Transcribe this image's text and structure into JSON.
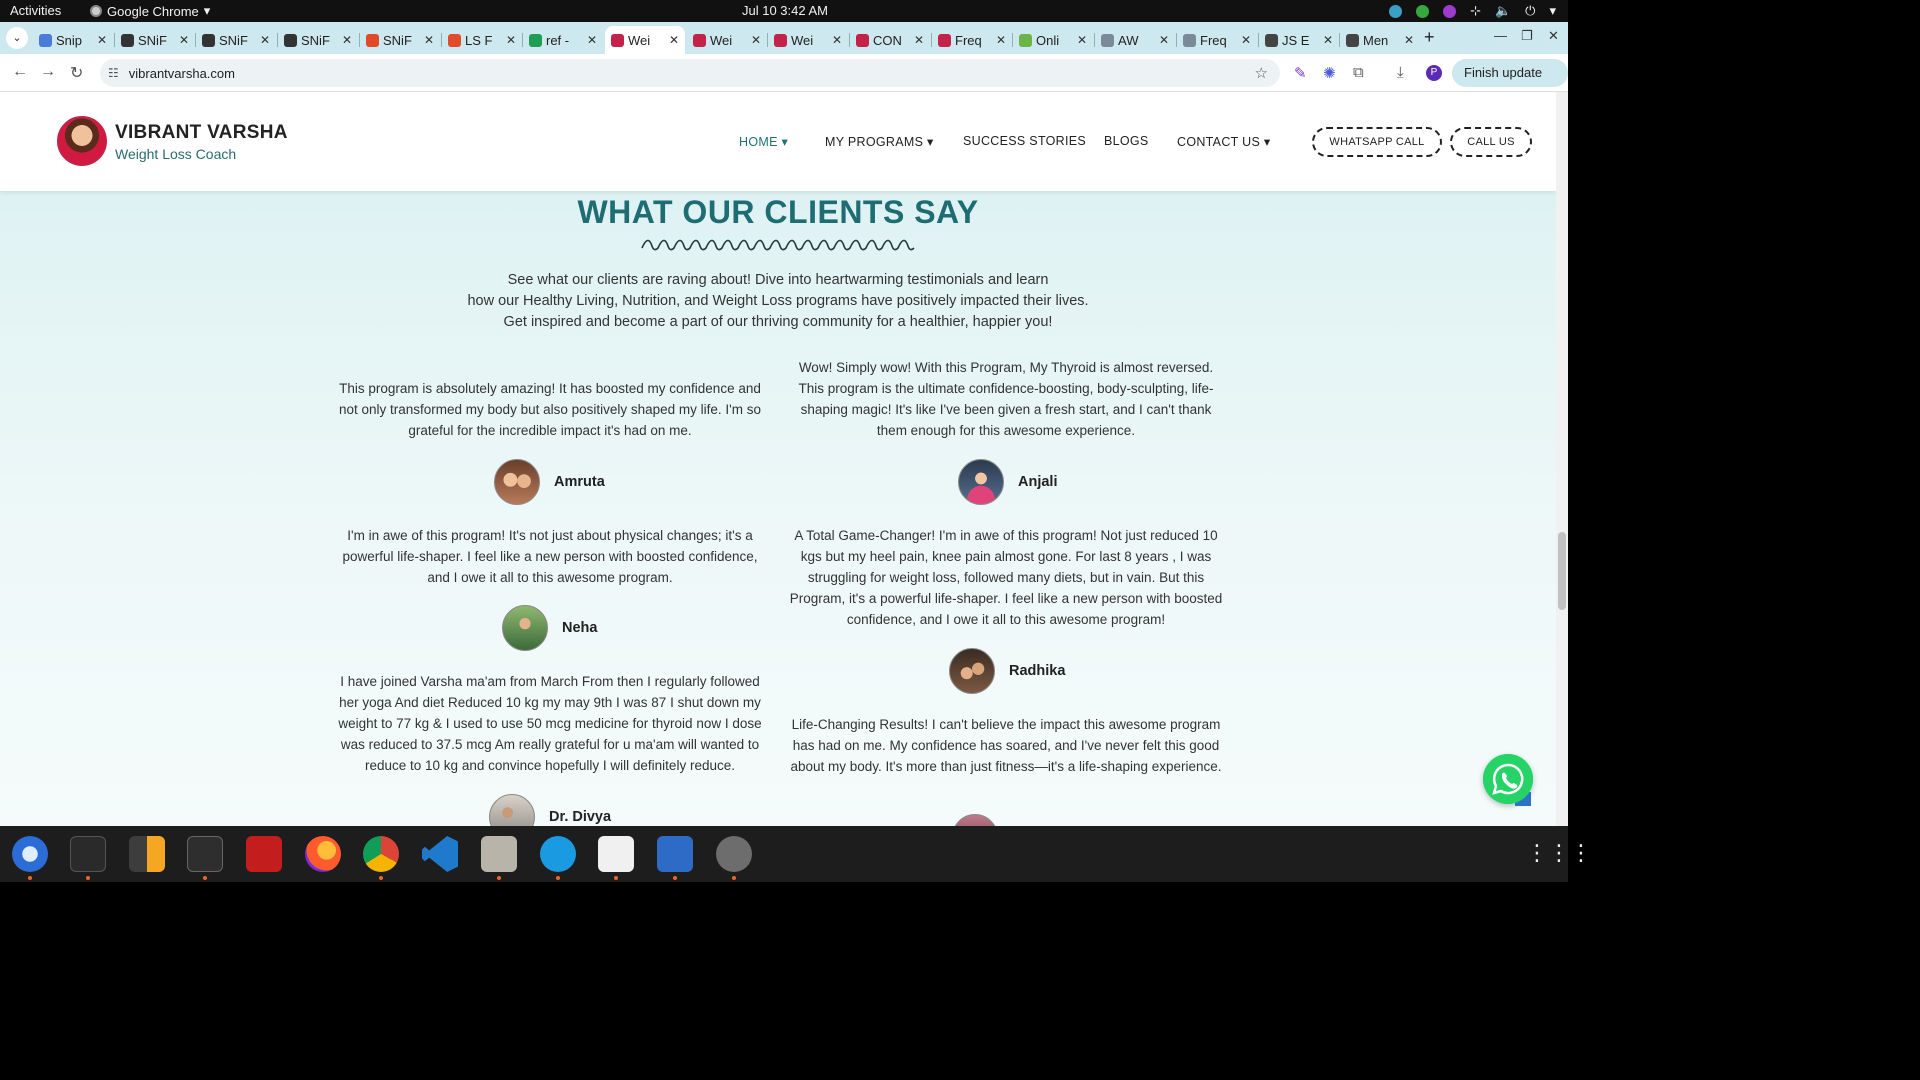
{
  "system": {
    "activities": "Activities",
    "app_name": "Google Chrome",
    "clock": "Jul 10  3:42 AM"
  },
  "tabs": [
    {
      "title": "Snip",
      "favicon_color": "#4a7bd8"
    },
    {
      "title": "SNiF",
      "favicon_color": "#333333"
    },
    {
      "title": "SNiF",
      "favicon_color": "#333333"
    },
    {
      "title": "SNiF",
      "favicon_color": "#333333"
    },
    {
      "title": "SNiF",
      "favicon_color": "#e04a2b"
    },
    {
      "title": "LS F",
      "favicon_color": "#e24c2a"
    },
    {
      "title": "ref -",
      "favicon_color": "#1e9e52"
    },
    {
      "title": "Wei",
      "favicon_color": "#c42349",
      "active": true
    },
    {
      "title": "Wei",
      "favicon_color": "#c42349"
    },
    {
      "title": "Wei",
      "favicon_color": "#c42349"
    },
    {
      "title": "CON",
      "favicon_color": "#c42349"
    },
    {
      "title": "Freq",
      "favicon_color": "#c42349"
    },
    {
      "title": "Onli",
      "favicon_color": "#6cb34a"
    },
    {
      "title": "AW",
      "favicon_color": "#7a8a99"
    },
    {
      "title": "Freq",
      "favicon_color": "#7a8a99"
    },
    {
      "title": "JS E",
      "favicon_color": "#444444"
    },
    {
      "title": "Men",
      "favicon_color": "#444444"
    }
  ],
  "toolbar": {
    "url": "vibrantvarsha.com",
    "finish_update": "Finish update",
    "profile_initial": "P"
  },
  "site": {
    "brand_name": "VIBRANT VARSHA",
    "brand_tagline": "Weight Loss Coach",
    "nav": {
      "home": "HOME",
      "programs": "MY PROGRAMS",
      "success": "SUCCESS STORIES",
      "blogs": "BLOGS",
      "contact": "CONTACT US",
      "whatsapp_call": "WHATSAPP CALL",
      "call_us": "CALL US"
    },
    "section_title": "WHAT OUR CLIENTS SAY",
    "intro": [
      "See what our clients are raving about! Dive into heartwarming testimonials and learn",
      "how our Healthy Living, Nutrition, and Weight Loss programs have positively impacted their lives.",
      "Get inspired and become a part of our thriving community for a healthier, happier you!"
    ],
    "testimonials": [
      {
        "quote": "This program is absolutely amazing! It has boosted my confidence and not only transformed my body but also positively shaped my life. I'm so grateful for the incredible impact it's had on me.",
        "name": "Amruta"
      },
      {
        "quote": "Wow! Simply wow! With this Program, My Thyroid is almost reversed. This program is the ultimate confidence-boosting, body-sculpting, life-shaping magic! It's like I've been given a fresh start, and I can't thank them enough for this awesome experience.",
        "name": "Anjali"
      },
      {
        "quote": "I'm in awe of this program! It's not just about physical changes; it's a powerful life-shaper. I feel like a new person with boosted confidence, and I owe it all to this awesome program.",
        "name": "Neha"
      },
      {
        "quote": "A Total Game-Changer! I'm in awe of this program! Not just reduced 10 kgs but my heel pain, knee pain almost gone. For last 8 years , I was struggling for weight loss, followed many diets, but in vain. But this Program, it's a powerful life-shaper. I feel like a new person with boosted confidence, and I owe it all to this awesome program!",
        "name": "Radhika"
      },
      {
        "quote": "I have joined Varsha ma'am from March From then I regularly followed her yoga And diet Reduced 10 kg my may 9th I was 87 I shut down my weight to 77 kg & I used to use 50 mcg medicine for thyroid now I dose was reduced to 37.5 mcg Am really grateful for u ma'am will wanted to reduce to 10 kg and convince hopefully I will definitely reduce.",
        "name": "Dr. Divya"
      },
      {
        "quote": "Life-Changing Results! I can't believe the impact this awesome program has had on me. My confidence has soared, and I've never felt this good about my body. It's more than just fitness—it's a life-shaping experience."
      }
    ]
  }
}
